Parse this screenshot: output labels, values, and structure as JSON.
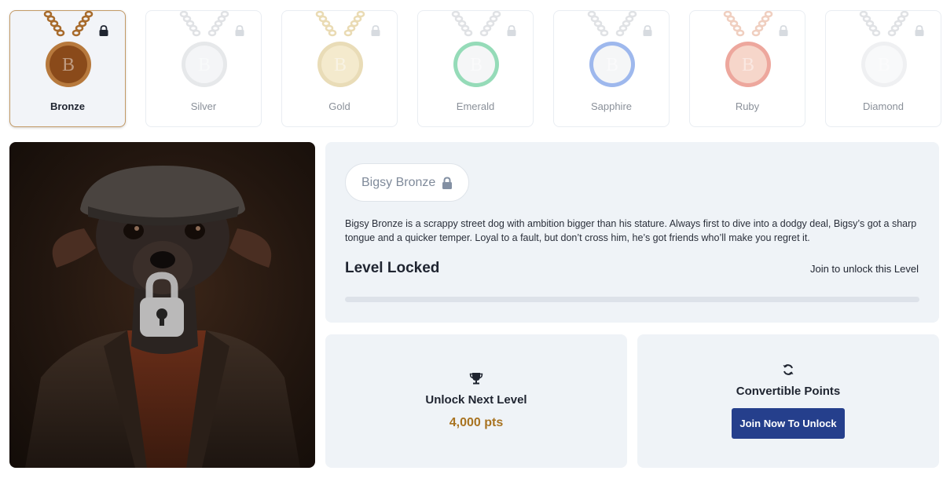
{
  "tiers": [
    {
      "name": "Bronze",
      "active": true,
      "chain": "#a86b2c",
      "disc": "#8a4a1a",
      "rim": "#b7793d"
    },
    {
      "name": "Silver",
      "active": false,
      "chain": "#c8cbd0",
      "disc": "#eceef1",
      "rim": "#d3d6da"
    },
    {
      "name": "Gold",
      "active": false,
      "chain": "#d9bf78",
      "disc": "#ecd9a6",
      "rim": "#d8c07d"
    },
    {
      "name": "Emerald",
      "active": false,
      "chain": "#c8cbd0",
      "disc": "#eef0f2",
      "rim": "#3fbf7f"
    },
    {
      "name": "Sapphire",
      "active": false,
      "chain": "#c8cbd0",
      "disc": "#eef0f2",
      "rim": "#4f7fe0"
    },
    {
      "name": "Ruby",
      "active": false,
      "chain": "#e4a98e",
      "disc": "#f0b6a0",
      "rim": "#e0604e"
    },
    {
      "name": "Diamond",
      "active": false,
      "chain": "#c8cbd0",
      "disc": "#f4f5f7",
      "rim": "#e2e4e8"
    }
  ],
  "character": {
    "name": "Bigsy Bronze",
    "description": "Bigsy Bronze is a scrappy street dog with ambition bigger than his stature. Always first to dive into a dodgy deal, Bigsy’s got a sharp tongue and a quicker temper. Loyal to a fault, but don’t cross him, he’s got friends who’ll make you regret it."
  },
  "level": {
    "status": "Level Locked",
    "join_text": "Join to unlock this Level",
    "progress": 0
  },
  "unlock_card": {
    "title": "Unlock Next Level",
    "points": "4,000 pts"
  },
  "points_card": {
    "title": "Convertible Points",
    "button_label": "Join Now To Unlock"
  },
  "colors": {
    "accent": "#253f8c",
    "points": "#a87321",
    "active_border": "#c39a66"
  }
}
